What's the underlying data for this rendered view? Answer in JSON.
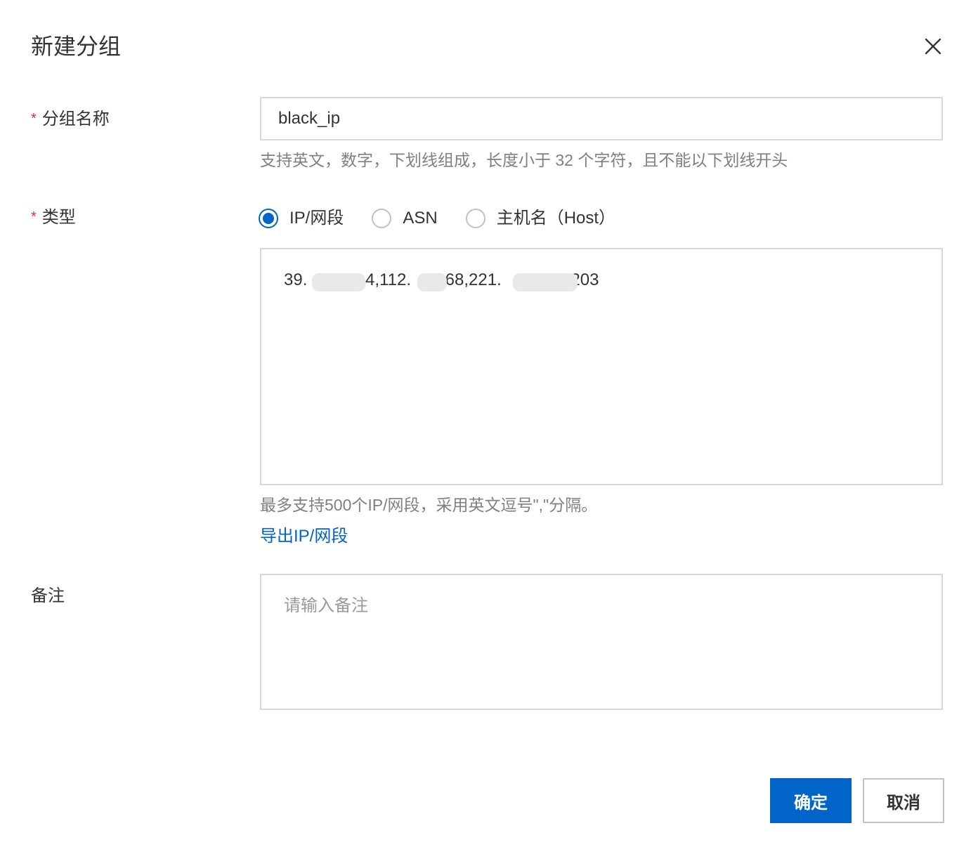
{
  "dialog": {
    "title": "新建分组"
  },
  "form": {
    "group_name": {
      "label": "分组名称",
      "required_mark": "*",
      "value": "black_ip",
      "hint": "支持英文，数字，下划线组成，长度小于 32 个字符，且不能以下划线开头"
    },
    "type": {
      "label": "类型",
      "required_mark": "*",
      "options": [
        {
          "label": "IP/网段",
          "checked": true
        },
        {
          "label": "ASN",
          "checked": false
        },
        {
          "label": "主机名（Host）",
          "checked": false
        }
      ],
      "ip_value_parts": [
        "39.",
        ".4,112.",
        ".68,221.",
        ".203"
      ],
      "hint": "最多支持500个IP/网段，采用英文逗号\",\"分隔。",
      "export_link": "导出IP/网段"
    },
    "note": {
      "label": "备注",
      "placeholder": "请输入备注"
    }
  },
  "footer": {
    "confirm_label": "确定",
    "cancel_label": "取消"
  },
  "colors": {
    "primary": "#0064c8",
    "required": "#e62e2e",
    "border": "#d7d8d9",
    "hint": "#808080"
  },
  "icons": {
    "close": "close-icon"
  }
}
